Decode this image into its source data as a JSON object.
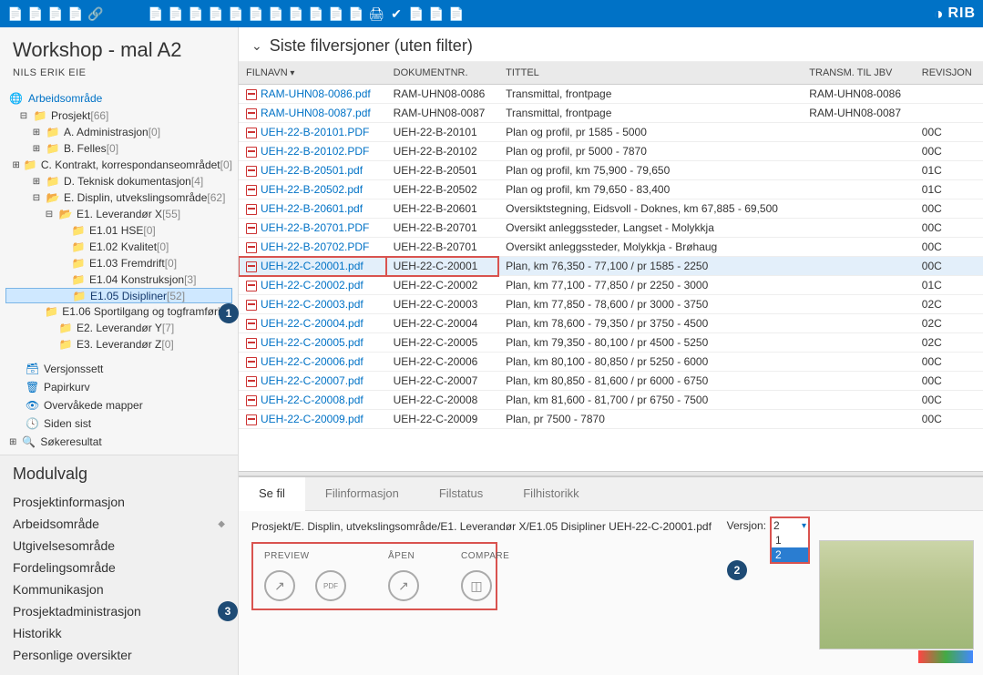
{
  "app": {
    "brand": "RIB",
    "title": "Workshop - mal A2",
    "user": "NILS ERIK EIE"
  },
  "tree": {
    "root": "Arbeidsområde",
    "items": [
      {
        "indent": 1,
        "icon": "folder",
        "label": "Prosjekt",
        "count": "[66]",
        "toggle": "-"
      },
      {
        "indent": 2,
        "icon": "folder",
        "label": "A. Administrasjon",
        "count": "[0]",
        "toggle": "+"
      },
      {
        "indent": 2,
        "icon": "folder",
        "label": "B. Felles",
        "count": "[0]",
        "toggle": "+"
      },
      {
        "indent": 2,
        "icon": "folder",
        "label": "C. Kontrakt, korrespondanseområdet",
        "count": "[0]",
        "toggle": "+"
      },
      {
        "indent": 2,
        "icon": "folder",
        "label": "D. Teknisk dokumentasjon",
        "count": "[4]",
        "toggle": "+"
      },
      {
        "indent": 2,
        "icon": "folderopen",
        "label": "E. Displin, utvekslingsområde",
        "count": "[62]",
        "toggle": "-"
      },
      {
        "indent": 3,
        "icon": "folderopen",
        "label": "E1. Leverandør X",
        "count": "[55]",
        "toggle": "-"
      },
      {
        "indent": 4,
        "icon": "folder",
        "label": "E1.01 HSE",
        "count": "[0]",
        "toggle": ""
      },
      {
        "indent": 4,
        "icon": "folder",
        "label": "E1.02 Kvalitet",
        "count": "[0]",
        "toggle": ""
      },
      {
        "indent": 4,
        "icon": "folder",
        "label": "E1.03 Fremdrift",
        "count": "[0]",
        "toggle": ""
      },
      {
        "indent": 4,
        "icon": "folder",
        "label": "E1.04 Konstruksjon",
        "count": "[3]",
        "toggle": ""
      },
      {
        "indent": 4,
        "icon": "folder",
        "label": "E1.05 Disipliner",
        "count": "[52]",
        "toggle": "",
        "selected": true
      },
      {
        "indent": 4,
        "icon": "folder",
        "label": "E1.06 Sportilgang og togframføring",
        "count": "",
        "toggle": ""
      },
      {
        "indent": 3,
        "icon": "folder",
        "label": "E2. Leverandør Y",
        "count": "[7]",
        "toggle": ""
      },
      {
        "indent": 3,
        "icon": "folder",
        "label": "E3. Leverandør Z",
        "count": "[0]",
        "toggle": ""
      }
    ],
    "sections": [
      {
        "icon": "versjon",
        "label": "Versjonssett"
      },
      {
        "icon": "papirkurv",
        "label": "Papirkurv"
      },
      {
        "icon": "overvakede",
        "label": "Overvåkede mapper"
      },
      {
        "icon": "siden",
        "label": "Siden sist"
      },
      {
        "icon": "sok",
        "label": "Søkeresultat"
      }
    ]
  },
  "modulvalg": {
    "title": "Modulvalg",
    "items": [
      "Prosjektinformasjon",
      "Arbeidsområde",
      "Utgivelsesområde",
      "Fordelingsområde",
      "Kommunikasjon",
      "Prosjektadministrasjon",
      "Historikk",
      "Personlige oversikter"
    ],
    "active": "Arbeidsområde"
  },
  "list": {
    "title": "Siste filversjoner (uten filter)",
    "columns": [
      "FILNAVN",
      "DOKUMENTNR.",
      "TITTEL",
      "TRANSM. TIL JBV",
      "REVISJON"
    ],
    "rows": [
      {
        "f": "RAM-UHN08-0086.pdf",
        "d": "RAM-UHN08-0086",
        "t": "Transmittal, frontpage",
        "j": "RAM-UHN08-0086",
        "r": ""
      },
      {
        "f": "RAM-UHN08-0087.pdf",
        "d": "RAM-UHN08-0087",
        "t": "Transmittal, frontpage",
        "j": "RAM-UHN08-0087",
        "r": ""
      },
      {
        "f": "UEH-22-B-20101.PDF",
        "d": "UEH-22-B-20101",
        "t": "Plan og profil, pr 1585 - 5000",
        "j": "",
        "r": "00C"
      },
      {
        "f": "UEH-22-B-20102.PDF",
        "d": "UEH-22-B-20102",
        "t": "Plan og profil, pr 5000 - 7870",
        "j": "",
        "r": "00C"
      },
      {
        "f": "UEH-22-B-20501.pdf",
        "d": "UEH-22-B-20501",
        "t": "Plan og profil, km 75,900 - 79,650",
        "j": "",
        "r": "01C"
      },
      {
        "f": "UEH-22-B-20502.pdf",
        "d": "UEH-22-B-20502",
        "t": "Plan og profil, km 79,650 - 83,400",
        "j": "",
        "r": "01C"
      },
      {
        "f": "UEH-22-B-20601.pdf",
        "d": "UEH-22-B-20601",
        "t": "Oversiktstegning, Eidsvoll - Doknes, km 67,885 - 69,500",
        "j": "",
        "r": "00C"
      },
      {
        "f": "UEH-22-B-20701.PDF",
        "d": "UEH-22-B-20701",
        "t": "Oversikt anleggssteder, Langset - Molykkja",
        "j": "",
        "r": "00C"
      },
      {
        "f": "UEH-22-B-20702.PDF",
        "d": "UEH-22-B-20701",
        "t": "Oversikt anleggssteder, Molykkja - Brøhaug",
        "j": "",
        "r": "00C"
      },
      {
        "f": "UEH-22-C-20001.pdf",
        "d": "UEH-22-C-20001",
        "t": "Plan, km 76,350 - 77,100 / pr 1585 - 2250",
        "j": "",
        "r": "00C",
        "selected": true
      },
      {
        "f": "UEH-22-C-20002.pdf",
        "d": "UEH-22-C-20002",
        "t": "Plan, km 77,100 - 77,850 / pr 2250 - 3000",
        "j": "",
        "r": "01C"
      },
      {
        "f": "UEH-22-C-20003.pdf",
        "d": "UEH-22-C-20003",
        "t": "Plan, km 77,850 - 78,600 / pr 3000 - 3750",
        "j": "",
        "r": "02C"
      },
      {
        "f": "UEH-22-C-20004.pdf",
        "d": "UEH-22-C-20004",
        "t": "Plan, km 78,600 - 79,350 / pr 3750 - 4500",
        "j": "",
        "r": "02C"
      },
      {
        "f": "UEH-22-C-20005.pdf",
        "d": "UEH-22-C-20005",
        "t": "Plan, km 79,350 - 80,100 / pr 4500 - 5250",
        "j": "",
        "r": "02C"
      },
      {
        "f": "UEH-22-C-20006.pdf",
        "d": "UEH-22-C-20006",
        "t": "Plan, km 80,100 - 80,850 / pr 5250 - 6000",
        "j": "",
        "r": "00C"
      },
      {
        "f": "UEH-22-C-20007.pdf",
        "d": "UEH-22-C-20007",
        "t": "Plan, km 80,850 - 81,600 / pr 6000 - 6750",
        "j": "",
        "r": "00C"
      },
      {
        "f": "UEH-22-C-20008.pdf",
        "d": "UEH-22-C-20008",
        "t": "Plan, km 81,600 - 81,700 / pr 6750 - 7500",
        "j": "",
        "r": "00C"
      },
      {
        "f": "UEH-22-C-20009.pdf",
        "d": "UEH-22-C-20009",
        "t": "Plan, pr 7500 - 7870",
        "j": "",
        "r": "00C"
      }
    ]
  },
  "detail": {
    "tabs": [
      "Se fil",
      "Filinformasjon",
      "Filstatus",
      "Filhistorikk"
    ],
    "active": "Se fil",
    "path": "Prosjekt/E. Displin, utvekslingsområde/E1. Leverandør X/E1.05 Disipliner UEH-22-C-20001.pdf",
    "versjon_label": "Versjon:",
    "versjon_selected": "2",
    "versjon_options": [
      "1",
      "2"
    ],
    "actions": {
      "preview": "PREVIEW",
      "apen": "ÅPEN",
      "compare": "COMPARE"
    }
  },
  "callouts": {
    "1": "1",
    "2": "2",
    "3": "3"
  }
}
